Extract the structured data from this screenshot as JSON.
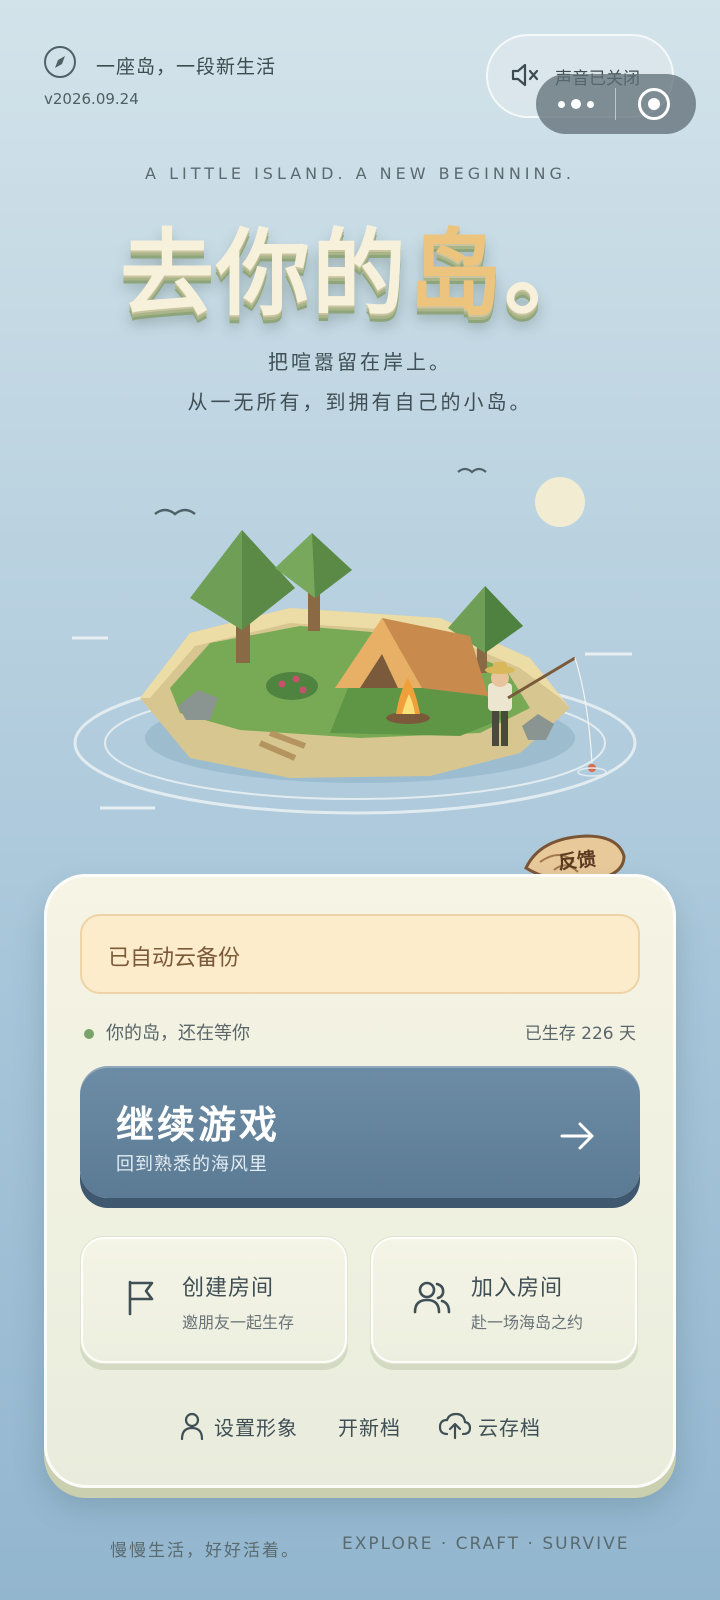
{
  "header": {
    "slogan": "一座岛，一段新生活",
    "version": "v2026.09.24",
    "sound_label": "声音已关闭"
  },
  "hero": {
    "subtitle_en": "A LITTLE ISLAND. A NEW BEGINNING.",
    "title_main": "去你的",
    "title_accent": "岛",
    "title_end": "。",
    "tagline_1": "把喧嚣留在岸上。",
    "tagline_2": "从一无所有，到拥有自己的小岛。"
  },
  "feedback_label": "反馈",
  "card": {
    "backup_text": "已自动云备份",
    "status_left": "你的岛，还在等你",
    "status_right": "已生存 226 天",
    "continue_title": "继续游戏",
    "continue_sub": "回到熟悉的海风里",
    "create_title": "创建房间",
    "create_sub": "邀朋友一起生存",
    "join_title": "加入房间",
    "join_sub": "赴一场海岛之约",
    "link_avatar": "设置形象",
    "link_new": "开新档",
    "link_cloud": "云存档"
  },
  "footer": {
    "cn": "慢慢生活，好好活着。",
    "en": "EXPLORE · CRAFT · SURVIVE"
  },
  "colors": {
    "accent_gold": "#edc47e",
    "primary_button": "#5b7a94",
    "backup_bg": "#fdeccb"
  }
}
